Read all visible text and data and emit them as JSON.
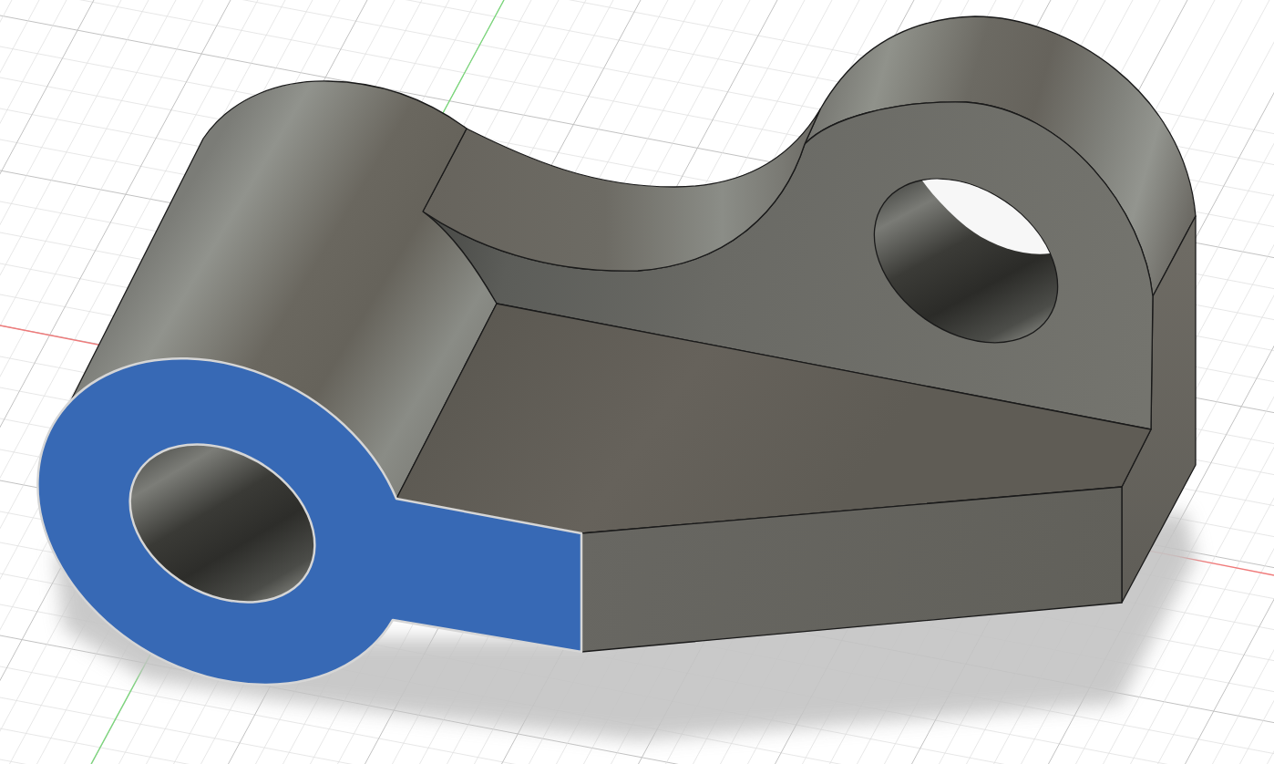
{
  "viewport": {
    "model": {
      "faces": [
        {
          "kind": "lug",
          "selected": false
        },
        {
          "kind": "side",
          "selected": false
        },
        {
          "kind": "web",
          "selected": false
        },
        {
          "kind": "rib",
          "selected": false
        },
        {
          "kind": "boss",
          "selected": false
        },
        {
          "kind": "base",
          "selected": false
        },
        {
          "kind": "front",
          "selected": false
        },
        {
          "kind": "end",
          "selected": true
        }
      ]
    }
  }
}
